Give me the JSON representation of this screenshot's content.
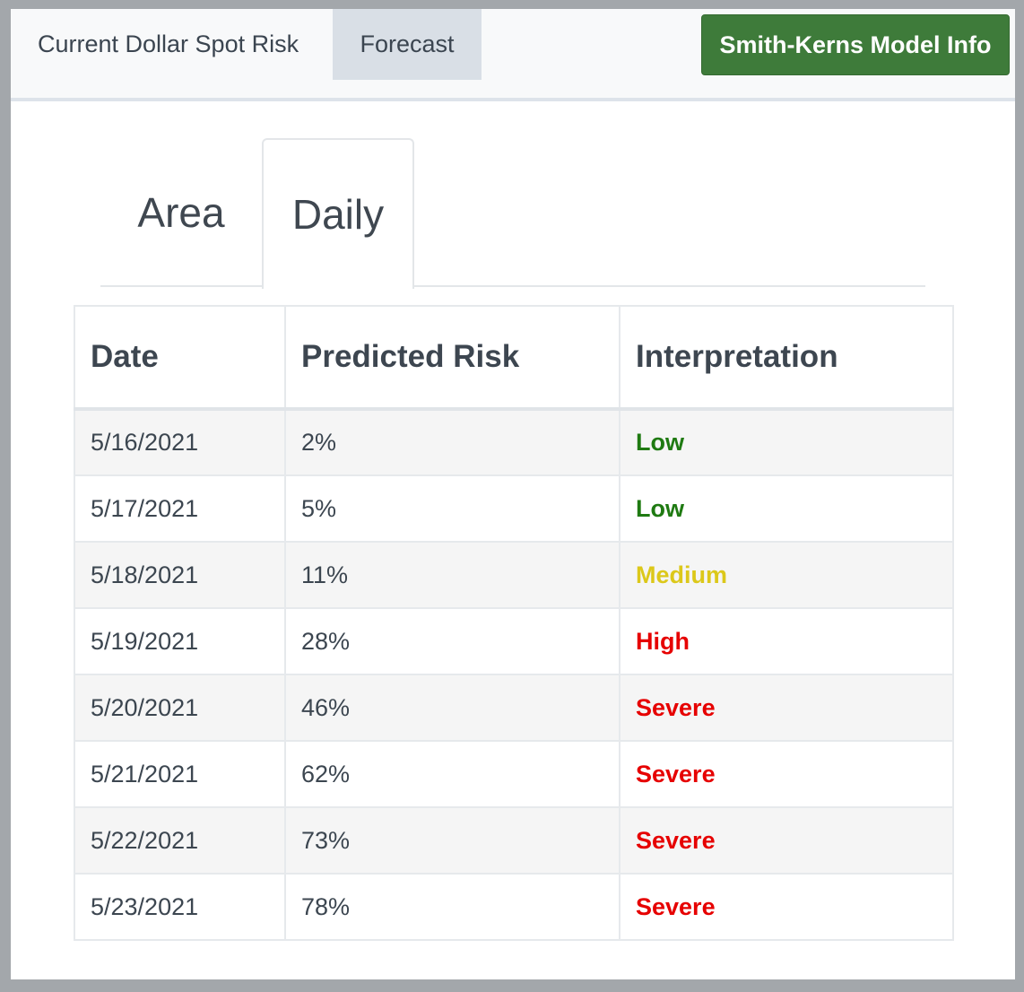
{
  "topnav": {
    "current_label": "Current Dollar Spot Risk",
    "forecast_label": "Forecast",
    "model_info_label": "Smith-Kerns Model Info"
  },
  "subtabs": {
    "area_label": "Area",
    "daily_label": "Daily"
  },
  "table": {
    "headers": [
      "Date",
      "Predicted Risk",
      "Interpretation"
    ],
    "rows": [
      {
        "date": "5/16/2021",
        "risk": "2%",
        "interpretation": "Low"
      },
      {
        "date": "5/17/2021",
        "risk": "5%",
        "interpretation": "Low"
      },
      {
        "date": "5/18/2021",
        "risk": "11%",
        "interpretation": "Medium"
      },
      {
        "date": "5/19/2021",
        "risk": "28%",
        "interpretation": "High"
      },
      {
        "date": "5/20/2021",
        "risk": "46%",
        "interpretation": "Severe"
      },
      {
        "date": "5/21/2021",
        "risk": "62%",
        "interpretation": "Severe"
      },
      {
        "date": "5/22/2021",
        "risk": "73%",
        "interpretation": "Severe"
      },
      {
        "date": "5/23/2021",
        "risk": "78%",
        "interpretation": "Severe"
      }
    ]
  },
  "colors": {
    "accent_button": "#3e7b3a",
    "Low": "#1f7a12",
    "Medium": "#dcc81a",
    "High": "#e60000",
    "Severe": "#e60000"
  }
}
